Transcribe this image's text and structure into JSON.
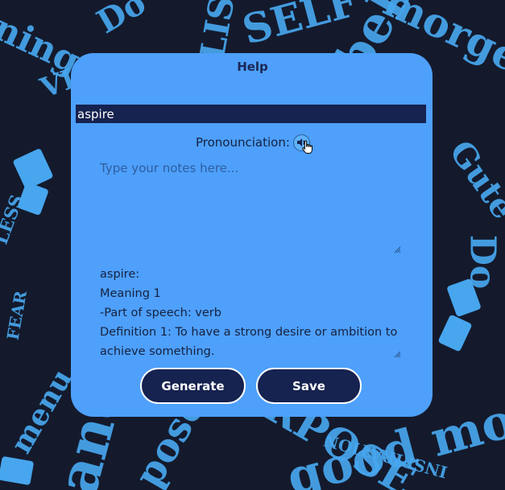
{
  "dialog": {
    "title": "Help",
    "word_value": "aspire",
    "pronunciation_label": "Pronounciation:",
    "notes_placeholder": "Type your notes here...",
    "definition_lines": [
      "aspire:",
      "Meaning 1",
      "-Part of speech: verb",
      "Definition 1: To have a strong desire or ambition to achieve something."
    ],
    "generate_label": "Generate",
    "save_label": "Save"
  },
  "icons": {
    "speaker": "speaker-icon",
    "cursor": "hand-cursor-icon",
    "resize": "resize-grip-icon"
  },
  "colors": {
    "background": "#141a2c",
    "dialog": "#4ea0fb",
    "dark_accent": "#16224f",
    "pattern": "#47a6ee"
  }
}
